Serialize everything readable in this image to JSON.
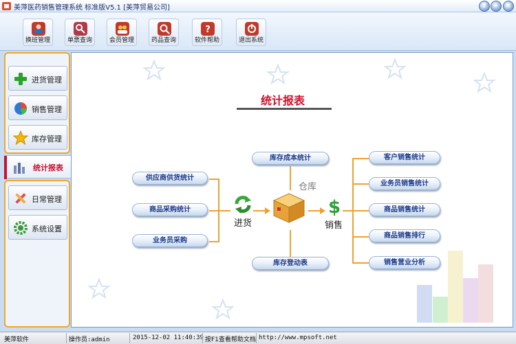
{
  "window": {
    "title": "美萍医药销售管理系统 标准版V5.1 [美萍贸易公司]",
    "buttons": {
      "help": "?",
      "minimize": "–",
      "close": "×"
    }
  },
  "toolbar": {
    "items": [
      {
        "label": "换班管理",
        "icon": "shift-change-icon",
        "color": "#c0392b"
      },
      {
        "label": "单票查询",
        "icon": "receipt-search-icon",
        "color": "#b03a48"
      },
      {
        "label": "会员管理",
        "icon": "member-icon",
        "color": "#c0392b"
      },
      {
        "label": "药品查询",
        "icon": "medicine-search-icon",
        "color": "#c0392b"
      },
      {
        "label": "软件帮助",
        "icon": "help-icon",
        "color": "#c0392b"
      },
      {
        "label": "退出系统",
        "icon": "exit-icon",
        "color": "#c0392b"
      }
    ]
  },
  "sidebar": {
    "items": [
      {
        "label": "进货管理",
        "icon": "plus-icon",
        "color": "#2aa32a"
      },
      {
        "label": "销售管理",
        "icon": "pie-chart-icon",
        "color": "#2b7bd6"
      },
      {
        "label": "库存管理",
        "icon": "star-icon",
        "color": "#f5b800"
      }
    ],
    "active": {
      "label": "统计报表",
      "icon": "bar-chart-icon",
      "color": "#c8102e"
    },
    "items2": [
      {
        "label": "日常管理",
        "icon": "tools-icon",
        "color": "#d9534f"
      },
      {
        "label": "系统设置",
        "icon": "gear-icon",
        "color": "#3a9a3a"
      }
    ]
  },
  "main": {
    "title": "统计报表",
    "left_reports": [
      "供应商供货统计",
      "商品采购统计",
      "业务员采购"
    ],
    "top_report": "库存成本统计",
    "bottom_report": "库存登动表",
    "right_reports": [
      "客户销售统计",
      "业务员销售统计",
      "商品销售统计",
      "商品销售排行",
      "销售营业分析"
    ],
    "flow": {
      "purchase": "进货",
      "warehouse": "仓库",
      "sales": "销售"
    },
    "icons": {
      "purchase": "recycle-arrow-icon",
      "warehouse": "box-icon",
      "sales": "dollar-icon"
    },
    "colors": {
      "connector": "#f0a030",
      "title": "#d0102a"
    }
  },
  "status": {
    "company": "美萍软件",
    "operator": "操作员:admin",
    "datetime": "2015-12-02 11:40:39",
    "help": "按F1查看帮助文档",
    "url": "http://www.mpsoft.net"
  }
}
